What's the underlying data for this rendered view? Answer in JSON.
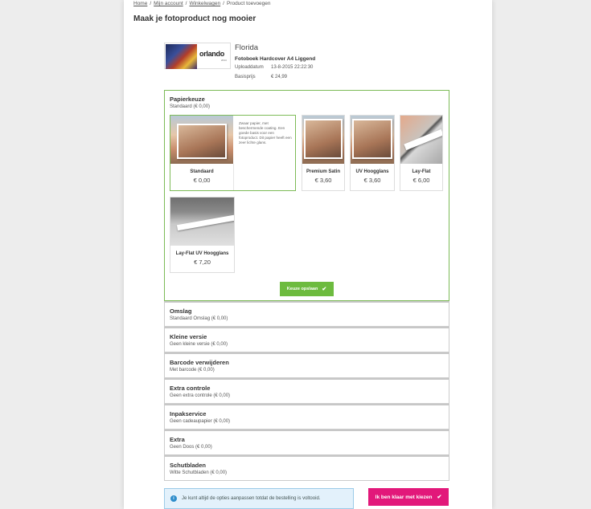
{
  "breadcrumb": {
    "items": [
      "Home",
      "Mijn account",
      "Winkelwagen"
    ],
    "current": "Product toevoegen"
  },
  "page_title": "Maak je fotoproduct nog mooier",
  "product": {
    "thumb_logo": "orlando",
    "thumb_logo_sub": "2014",
    "name": "Florida",
    "type": "Fotoboek Hardcover A4 Liggend",
    "upload_label": "Uploaddatum",
    "upload_value": "13-8-2015 22:22:30",
    "price_label": "Basisprijs",
    "price_value": "€ 24,99"
  },
  "paper": {
    "title": "Papierkeuze",
    "current": "Standaard (€ 0,00)",
    "options": [
      {
        "name": "Standaard",
        "price": "€ 0,00",
        "selected": true,
        "description": "Zwaar papier, met beschermende coating. Een goede basis voor een fotoproduct. Dit papier heeft een zeer lichte glans."
      },
      {
        "name": "Premium Satin",
        "price": "€ 3,60"
      },
      {
        "name": "UV Hoogglans",
        "price": "€ 3,60"
      },
      {
        "name": "Lay-Flat",
        "price": "€ 6,00"
      },
      {
        "name": "Lay-Flat UV Hoogglans",
        "price": "€ 7,20"
      }
    ],
    "save_label": "Keuze opslaan"
  },
  "sections": [
    {
      "title": "Omslag",
      "sub": "Standaard Omslag (€ 0,00)"
    },
    {
      "title": "Kleine versie",
      "sub": "Geen kleine versie (€ 0,00)"
    },
    {
      "title": "Barcode verwijderen",
      "sub": "Met barcode (€ 0,00)"
    },
    {
      "title": "Extra controle",
      "sub": "Geen extra controle (€ 0,00)"
    },
    {
      "title": "Inpakservice",
      "sub": "Geen cadeaupapier (€ 0,00)"
    },
    {
      "title": "Extra",
      "sub": "Geen Doos (€ 0,00)"
    },
    {
      "title": "Schutbladen",
      "sub": "Witte Schutbladen (€ 0,00)"
    }
  ],
  "notice": "Je kunt altijd de opties aanpassen totdat de bestelling is voltooid.",
  "done_label": "Ik ben klaar met kiezen",
  "colors": {
    "accent_green": "#6dbb3f",
    "accent_pink": "#e2187a",
    "info_blue": "#2e8dcb"
  }
}
